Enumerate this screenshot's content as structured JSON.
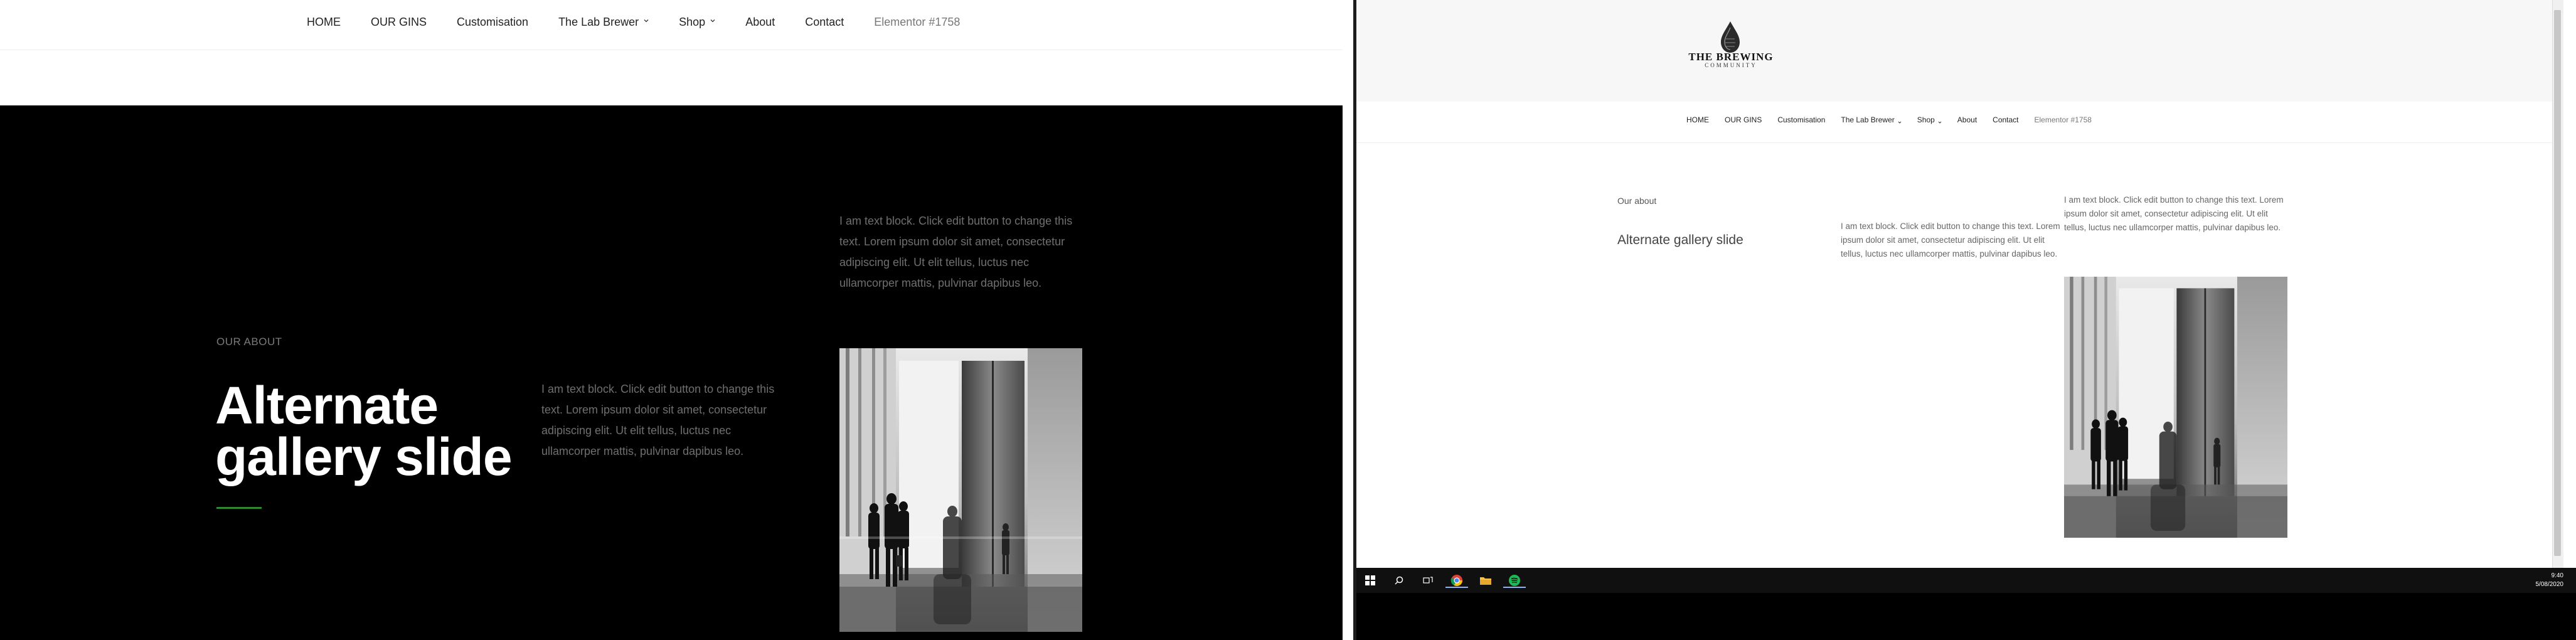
{
  "nav": {
    "items": [
      {
        "label": "HOME"
      },
      {
        "label": "OUR GINS"
      },
      {
        "label": "Customisation"
      },
      {
        "label": "The Lab Brewer"
      },
      {
        "label": "Shop"
      },
      {
        "label": "About"
      },
      {
        "label": "Contact"
      },
      {
        "label": "Elementor #1758"
      }
    ]
  },
  "left_section": {
    "eyebrow": "OUR ABOUT",
    "title": "Alternate gallery slide",
    "accent_color": "#2f8a2f",
    "text_left": "I am text block. Click edit button to change this text. Lorem ipsum dolor sit amet, consectetur adipiscing elit. Ut elit tellus, luctus nec ullamcorper mattis, pulvinar dapibus leo.",
    "text_right": "I am text block. Click edit button to change this text. Lorem ipsum dolor sit amet, consectetur adipiscing elit. Ut elit tellus, luctus nec ullamcorper mattis, pulvinar dapibus leo."
  },
  "right_section": {
    "brand_name": "THE BREWING",
    "brand_sub": "COMMUNITY",
    "eyebrow": "Our about",
    "title": "Alternate gallery slide",
    "text_left": "I am text block. Click edit button to change this text. Lorem ipsum dolor sit amet, consectetur adipiscing elit. Ut elit tellus, luctus nec ullamcorper mattis, pulvinar dapibus leo.",
    "text_right": "I am text block. Click edit button to change this text. Lorem ipsum dolor sit amet, consectetur adipiscing elit. Ut elit tellus, luctus nec ullamcorper mattis, pulvinar dapibus leo."
  },
  "taskbar": {
    "icons": [
      "windows-start-icon",
      "search-icon",
      "task-view-icon",
      "chrome-icon",
      "file-explorer-icon",
      "spotify-icon"
    ],
    "time": "9:40",
    "date": "5/08/2020"
  }
}
